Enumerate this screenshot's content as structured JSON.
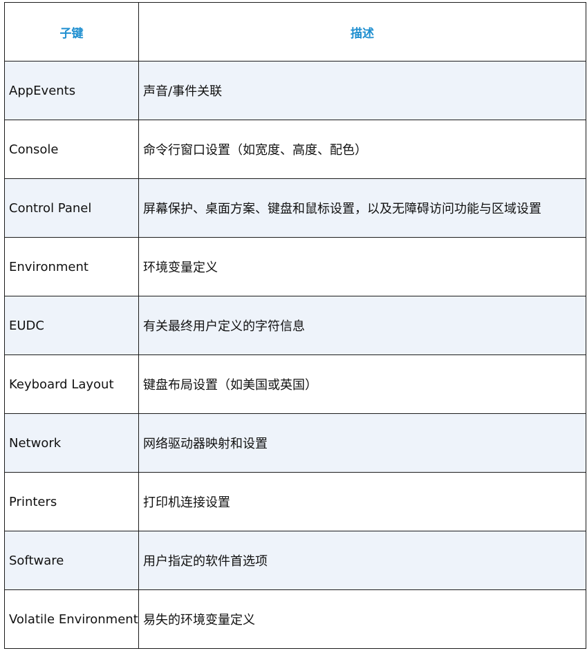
{
  "header": {
    "key": "子键",
    "desc": "描述"
  },
  "colors": {
    "header_text": "#1f8fd0",
    "row_shade": "#eef3fa",
    "border": "#1a1a1a"
  },
  "rows": [
    {
      "key": "AppEvents",
      "desc": "声音/事件关联"
    },
    {
      "key": "Console",
      "desc": "命令行窗口设置（如宽度、高度、配色）"
    },
    {
      "key": "Control Panel",
      "desc": "屏幕保护、桌面方案、键盘和鼠标设置，以及无障碍访问功能与区域设置"
    },
    {
      "key": "Environment",
      "desc": "环境变量定义"
    },
    {
      "key": "EUDC",
      "desc": "有关最终用户定义的字符信息"
    },
    {
      "key": "Keyboard Layout",
      "desc": "键盘布局设置（如美国或英国）"
    },
    {
      "key": "Network",
      "desc": "网络驱动器映射和设置"
    },
    {
      "key": "Printers",
      "desc": "打印机连接设置"
    },
    {
      "key": "Software",
      "desc": "用户指定的软件首选项"
    },
    {
      "key": "Volatile Environment",
      "desc": "易失的环境变量定义"
    }
  ]
}
